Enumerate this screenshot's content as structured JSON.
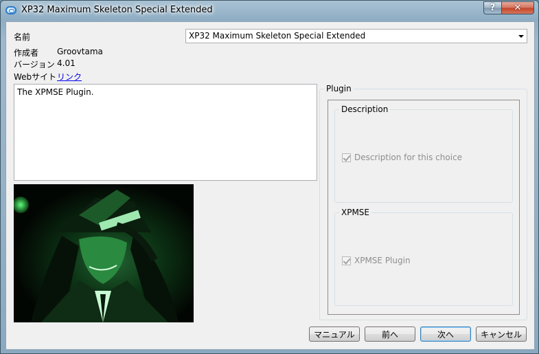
{
  "window": {
    "title": "XP32 Maximum Skeleton Special Extended",
    "help_label": "?",
    "close_label": "✕"
  },
  "info": {
    "name_label": "名前",
    "name_value": "XP32 Maximum Skeleton Special Extended",
    "author_label": "作成者",
    "author_value": "Groovtama",
    "version_label": "バージョン",
    "version_value": "4.01",
    "website_label": "Webサイト",
    "website_link": "リンク"
  },
  "description_text": "The XPMSE Plugin.",
  "plugin_group": {
    "label": "Plugin",
    "groups": [
      {
        "label": "Description",
        "option": "Description for this choice",
        "checked": true
      },
      {
        "label": "XPMSE",
        "option": "XPMSE Plugin",
        "checked": true
      }
    ]
  },
  "buttons": {
    "manual": "マニュアル",
    "back": "前へ",
    "next": "次へ",
    "cancel": "キャンセル"
  },
  "colors": {
    "accent_link": "#0000ee",
    "close_red": "#c1442a",
    "image_green": "#1f8a3a"
  }
}
